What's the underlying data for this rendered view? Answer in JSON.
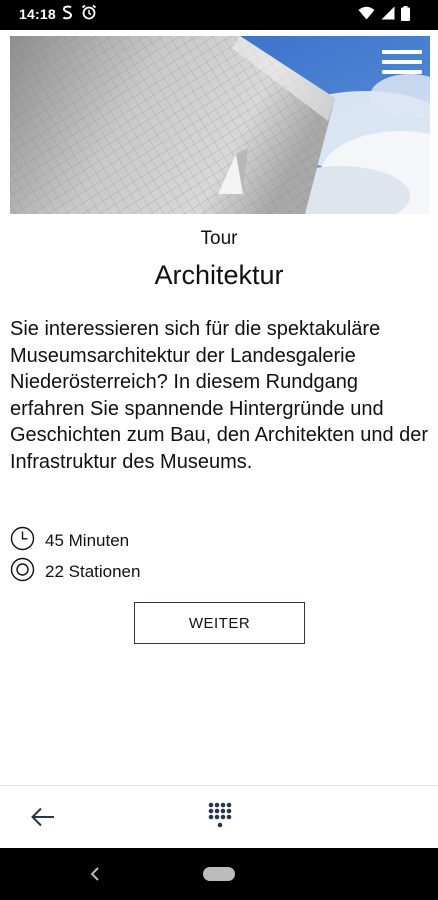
{
  "status_bar": {
    "time": "14:18",
    "icons": [
      "s-sim-icon",
      "alarm-icon",
      "wifi-icon",
      "signal-icon",
      "battery-icon"
    ]
  },
  "header": {
    "menu_icon": "hamburger-menu-icon"
  },
  "tour": {
    "kicker": "Tour",
    "title": "Architektur",
    "description": "Sie interessieren sich für die spektakuläre Museumsarchitektur der Landesgalerie Niederösterreich? In diesem Rundgang erfahren Sie spannende Hintergründe und Geschichten zum Bau, den Architekten und der Infrastruktur des Museums.",
    "duration": "45 Minuten",
    "stations": "22 Stationen",
    "continue_label": "WEITER"
  },
  "bottom_bar": {
    "back_icon": "arrow-left-icon",
    "keypad_icon": "keypad-icon"
  },
  "colors": {
    "accent": "#2a3552",
    "status_bar": "#000000",
    "text": "#111111"
  }
}
